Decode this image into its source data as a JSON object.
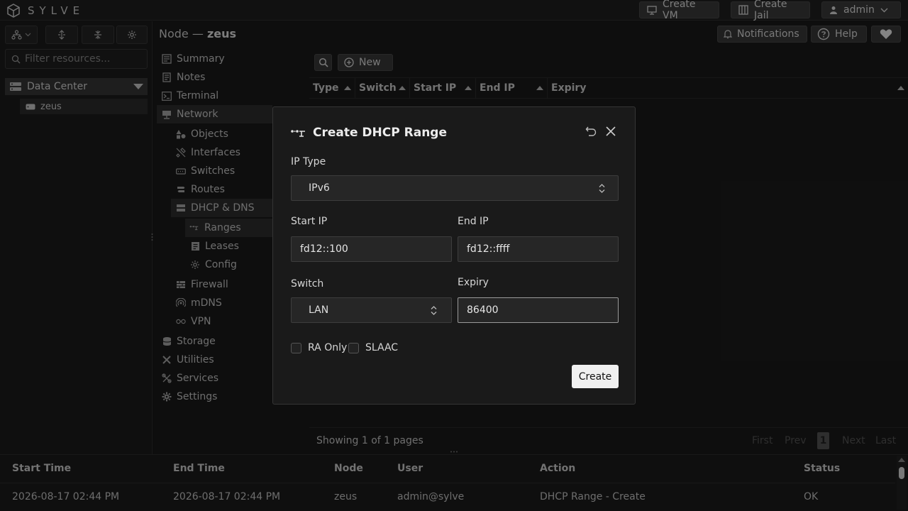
{
  "app": {
    "name": "SYLVE"
  },
  "topbar": {
    "create_vm": "Create VM",
    "create_jail": "Create Jail",
    "user": "admin"
  },
  "sidebar": {
    "filter_placeholder": "Filter resources...",
    "datacenter": "Data Center",
    "node": "zeus"
  },
  "breadcrumb": {
    "prefix": "Node —",
    "node": "zeus"
  },
  "header_buttons": {
    "notifications": "Notifications",
    "help": "Help"
  },
  "nav": {
    "summary": "Summary",
    "notes": "Notes",
    "terminal": "Terminal",
    "network": "Network",
    "objects": "Objects",
    "interfaces": "Interfaces",
    "switches": "Switches",
    "routes": "Routes",
    "dhcp_dns": "DHCP & DNS",
    "ranges": "Ranges",
    "leases": "Leases",
    "config": "Config",
    "firewall": "Firewall",
    "mdns": "mDNS",
    "vpn": "VPN",
    "storage": "Storage",
    "utilities": "Utilities",
    "services": "Services",
    "settings": "Settings"
  },
  "toolbar": {
    "new_label": "New"
  },
  "table": {
    "columns": [
      "Type",
      "Switch",
      "Start IP",
      "End IP",
      "Expiry"
    ],
    "pagination_text": "Showing 1 of 1 pages",
    "pages": {
      "first": "First",
      "prev": "Prev",
      "current": "1",
      "next": "Next",
      "last": "Last"
    }
  },
  "log": {
    "columns": [
      "Start Time",
      "End Time",
      "Node",
      "User",
      "Action",
      "Status"
    ],
    "rows": [
      {
        "start": "2026-08-17 02:44 PM",
        "end": "2026-08-17 02:44 PM",
        "node": "zeus",
        "user": "admin@sylve",
        "action": "DHCP Range - Create",
        "status": "OK"
      }
    ]
  },
  "modal": {
    "title": "Create DHCP Range",
    "ip_type_label": "IP Type",
    "ip_type_value": "IPv6",
    "start_ip_label": "Start IP",
    "start_ip_value": "fd12::100",
    "end_ip_label": "End IP",
    "end_ip_value": "fd12::ffff",
    "switch_label": "Switch",
    "switch_value": "LAN",
    "expiry_label": "Expiry",
    "expiry_value": "86400",
    "ra_only_label": "RA Only",
    "slaac_label": "SLAAC",
    "create_label": "Create"
  }
}
